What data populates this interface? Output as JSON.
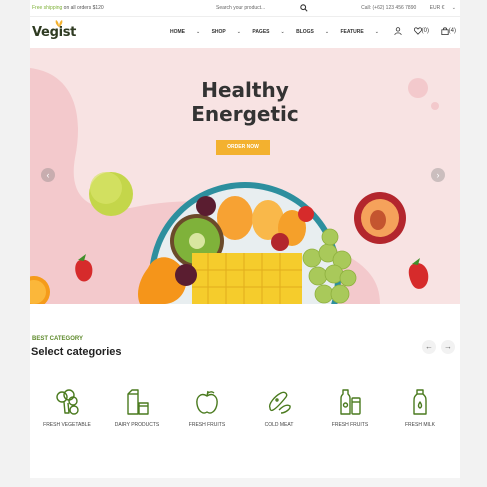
{
  "topbar": {
    "shipping_prefix": "Free shipping",
    "shipping_rest": " on all orders $120",
    "search_placeholder": "Search your product...",
    "call": "Call: (+62) 123 456 7890",
    "currency": "EUR €"
  },
  "header": {
    "logo": "Vegist",
    "nav": [
      {
        "label": "HOME"
      },
      {
        "label": "SHOP"
      },
      {
        "label": "PAGES"
      },
      {
        "label": "BLOGS"
      },
      {
        "label": "FEATURE"
      }
    ],
    "wishlist_count": "(0)",
    "cart_count": "(4)"
  },
  "hero": {
    "title_line1": "Healthy",
    "title_line2": "Energetic",
    "cta": "ORDER NOW"
  },
  "categories": {
    "kicker": "BEST CATEGORY",
    "title": "Select categories",
    "items": [
      {
        "label": "FRESH VEGETABLE",
        "icon": "broccoli-icon"
      },
      {
        "label": "DAIRY PRODUCTS",
        "icon": "milk-carton-icon"
      },
      {
        "label": "FRESH FRUITS",
        "icon": "apple-icon"
      },
      {
        "label": "COLD MEAT",
        "icon": "sausage-icon"
      },
      {
        "label": "FRESH FRUITS",
        "icon": "juice-bottle-icon"
      },
      {
        "label": "FRESH MILK",
        "icon": "milk-bottle-icon"
      }
    ]
  },
  "colors": {
    "accent": "#f3b12f",
    "green": "#5e8a2b",
    "hero_bg": "#f8e3e3"
  }
}
